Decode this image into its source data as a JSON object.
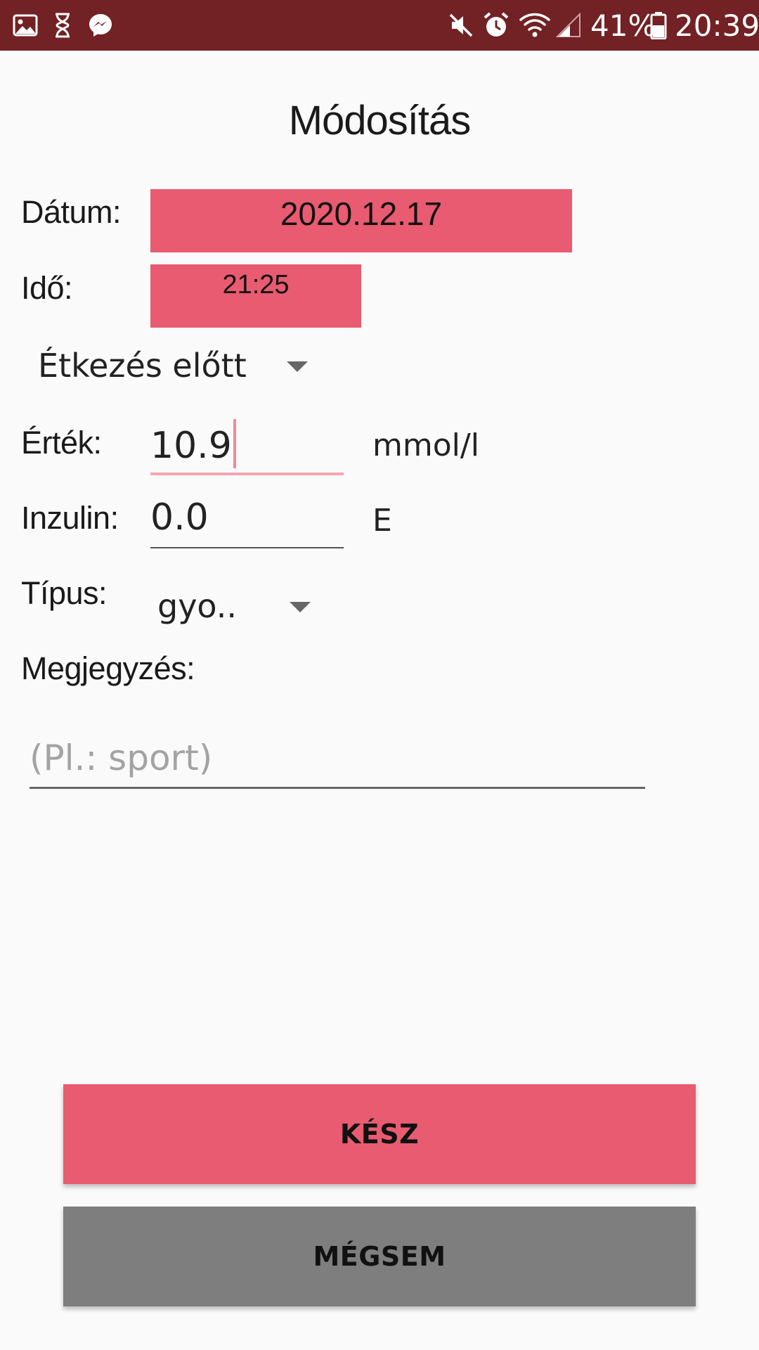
{
  "status_bar": {
    "icons_left": [
      "gallery-icon",
      "hourglass-icon",
      "messenger-icon"
    ],
    "icons_right": [
      "mute-icon",
      "alarm-icon",
      "wifi-icon",
      "signal-icon",
      "battery-icon"
    ],
    "battery_percent": "41%",
    "time": "20:39",
    "background_color": "#722124"
  },
  "title": "Módosítás",
  "date": {
    "label": "Dátum:",
    "value": "2020.12.17"
  },
  "time": {
    "label": "Idő:",
    "value": "21:25"
  },
  "meal_spinner": {
    "selected": "Étkezés előtt"
  },
  "value_field": {
    "label": "Érték:",
    "value": "10.9",
    "unit": "mmol/l"
  },
  "insulin_field": {
    "label": "Inzulin:",
    "value": "0.0",
    "unit": "E"
  },
  "type_spinner": {
    "label": "Típus:",
    "selected": "gyo.."
  },
  "note": {
    "label": "Megjegyzés:",
    "placeholder": "(Pl.: sport)"
  },
  "buttons": {
    "done": "KÉSZ",
    "cancel": "MÉGSEM"
  },
  "colors": {
    "accent": "#e95b70",
    "cancel": "#7f7e7f",
    "underline_active": "#f4a6b3"
  }
}
